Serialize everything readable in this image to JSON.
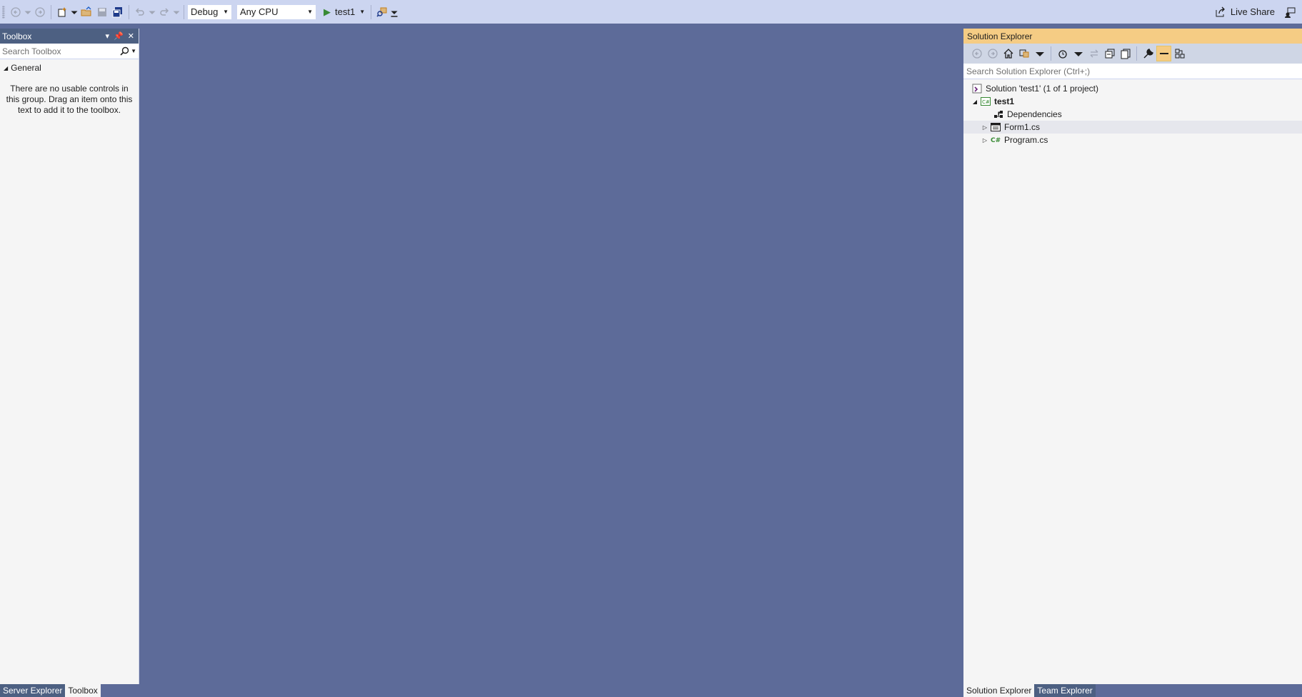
{
  "toolbar": {
    "configuration": "Debug",
    "platform": "Any CPU",
    "start_target": "test1",
    "live_share": "Live Share"
  },
  "toolbox": {
    "title": "Toolbox",
    "search_placeholder": "Search Toolbox",
    "group": "General",
    "empty_message": "There are no usable controls in this group. Drag an item onto this text to add it to the toolbox."
  },
  "solution_explorer": {
    "title": "Solution Explorer",
    "search_placeholder": "Search Solution Explorer (Ctrl+;)",
    "tree": [
      {
        "label": "Solution 'test1' (1 of 1 project)",
        "icon": "solution-icon"
      },
      {
        "label": "test1",
        "icon": "csharp-project-icon"
      },
      {
        "label": "Dependencies",
        "icon": "dependencies-icon"
      },
      {
        "label": "Form1.cs",
        "icon": "form-icon"
      },
      {
        "label": "Program.cs",
        "icon": "csharp-file-icon"
      }
    ]
  },
  "bottom_tabs": {
    "left": [
      "Server Explorer",
      "Toolbox"
    ],
    "right": [
      "Solution Explorer",
      "Team Explorer"
    ]
  },
  "colors": {
    "background": "#5d6b99",
    "toolbar": "#ccd5f0",
    "active_title": "#f5cc84",
    "panel_title": "#4d6082"
  }
}
